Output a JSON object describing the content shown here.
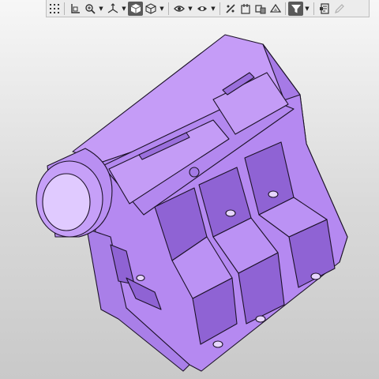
{
  "toolbar": {
    "buttons": [
      {
        "id": "grid",
        "icon": "grid-icon"
      },
      {
        "id": "coordinate-system",
        "icon": "axis-corner-icon"
      },
      {
        "id": "zoom",
        "icon": "zoom-icon",
        "dropdown": true
      },
      {
        "id": "orientation",
        "icon": "orientation-axes-icon",
        "dropdown": true
      },
      {
        "id": "shaded",
        "icon": "shaded-cube-icon",
        "active": true
      },
      {
        "id": "wireframe",
        "icon": "wireframe-cube-icon",
        "dropdown": true
      },
      {
        "id": "visibility",
        "icon": "eye-icon",
        "dropdown": true
      },
      {
        "id": "section-view",
        "icon": "section-eye-icon",
        "dropdown": true
      },
      {
        "id": "display-axes",
        "icon": "slash-axes-icon"
      },
      {
        "id": "display-sketches",
        "icon": "sketch-icon"
      },
      {
        "id": "display-components",
        "icon": "components-icon"
      },
      {
        "id": "display-surfaces",
        "icon": "surfaces-icon"
      },
      {
        "id": "filter",
        "icon": "filter-icon",
        "active": true,
        "dropdown": true
      },
      {
        "id": "properties",
        "icon": "properties-icon"
      },
      {
        "id": "edit",
        "icon": "pencil-icon",
        "disabled": true
      }
    ]
  },
  "model": {
    "color_face_top": "#c59cf7",
    "color_face_front": "#b589f1",
    "color_face_side": "#a67ae6",
    "color_edge": "#1c1228"
  }
}
